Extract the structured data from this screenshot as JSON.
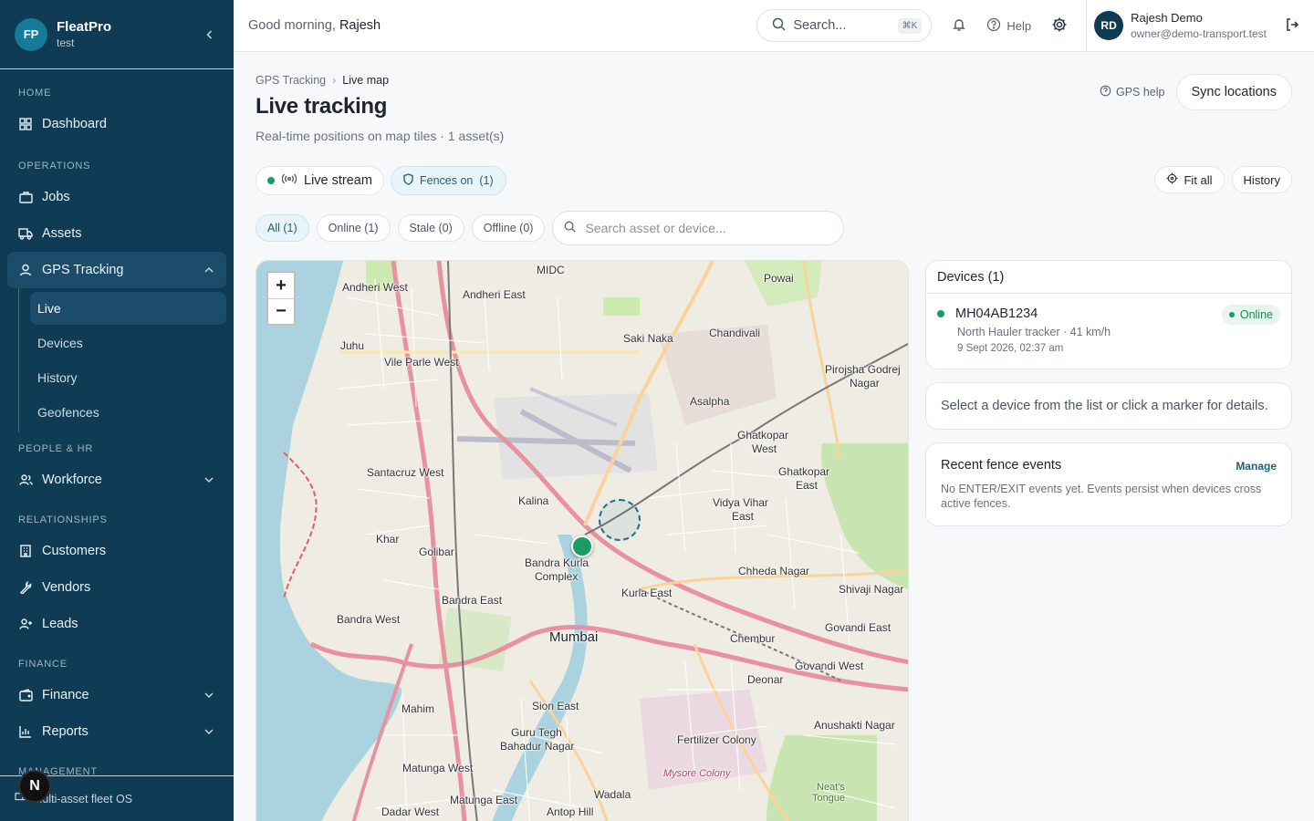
{
  "sidebar": {
    "brand": {
      "initials": "FP",
      "name": "FleatPro",
      "sub": "test"
    },
    "sections": {
      "home": "HOME",
      "operations": "OPERATIONS",
      "people": "PEOPLE & HR",
      "relationships": "RELATIONSHIPS",
      "finance": "FINANCE",
      "management": "MANAGEMENT"
    },
    "items": {
      "dashboard": "Dashboard",
      "jobs": "Jobs",
      "assets": "Assets",
      "gps": "GPS Tracking",
      "workforce": "Workforce",
      "customers": "Customers",
      "vendors": "Vendors",
      "leads": "Leads",
      "finance": "Finance",
      "reports": "Reports"
    },
    "gps_sub": {
      "live": "Live",
      "devices": "Devices",
      "history": "History",
      "geofences": "Geofences"
    },
    "footer": "Multi-asset fleet OS",
    "n_badge": "N"
  },
  "header": {
    "greeting": "Good morning,",
    "user_first": "Rajesh",
    "search_label": "Search...",
    "search_kbd": "⌘K",
    "help": "Help",
    "user_initials": "RD",
    "user_name": "Rajesh Demo",
    "user_email": "owner@demo-transport.test"
  },
  "page": {
    "breadcrumb_parent": "GPS Tracking",
    "breadcrumb_current": "Live map",
    "title": "Live tracking",
    "subtitle": "Real-time positions on map tiles · 1 asset(s)",
    "gps_help": "GPS help",
    "sync": "Sync locations",
    "live_stream": "Live stream",
    "fences_on": "Fences on",
    "fences_count": "(1)",
    "fit_all": "Fit all",
    "history": "History",
    "filters": [
      "All (1)",
      "Online (1)",
      "Stale (0)",
      "Offline (0)"
    ],
    "asset_search_placeholder": "Search asset or device..."
  },
  "map": {
    "zoom_in": "+",
    "zoom_out": "−",
    "labels": {
      "andheri_west": "Andheri West",
      "andheri_east": "Andheri East",
      "midc": "MIDC",
      "powai": "Powai",
      "juhu": "Juhu",
      "vile_parle": "Vile Parle West",
      "saki_naka": "Saki Naka",
      "chandivali": "Chandivali",
      "pirojsha": "Pirojsha Godrej",
      "nagar": "Nagar",
      "asalpha": "Asalpha",
      "ghatkopar_w": "Ghatkopar",
      "ghatkopar_w2": "West",
      "ghatkopar_e": "Ghatkopar",
      "ghatkopar_e2": "East",
      "santacruz": "Santacruz West",
      "kalina": "Kalina",
      "vidya": "Vidya Vihar",
      "vidya2": "East",
      "khar": "Khar",
      "golibar": "Golibar",
      "bkc": "Bandra Kurla",
      "bkc2": "Complex",
      "chheda": "Chheda Nagar",
      "shivaji": "Shivaji Nagar",
      "kurla_east": "Kurla East",
      "bandra_east": "Bandra East",
      "bandra_west": "Bandra West",
      "mumbai": "Mumbai",
      "chembur": "Chembur",
      "govandi_east": "Govandi East",
      "govandi_west": "Govandi West",
      "deonar": "Deonar",
      "mahim": "Mahim",
      "sion_east": "Sion East",
      "anushakti": "Anushakti Nagar",
      "guru": "Guru Tegh",
      "guru2": "Bahadur Nagar",
      "fertilizer": "Fertilizer Colony",
      "matunga_w": "Matunga West",
      "matunga_e": "Matunga East",
      "wadala": "Wadala",
      "dadar": "Dadar West",
      "antop": "Antop Hill",
      "mysore": "Mysore Colony",
      "neats": "Neat's",
      "neats2": "Tongue"
    }
  },
  "devices_panel": {
    "title": "Devices (1)",
    "device_id": "MH04AB1234",
    "device_meta": "North Hauler tracker · 41 km/h",
    "device_time": "9 Sept 2026, 02:37 am",
    "status": "Online",
    "hint": "Select a device from the list or click a marker for details."
  },
  "fence_events": {
    "title": "Recent fence events",
    "manage": "Manage",
    "text": "No ENTER/EXIT events yet. Events persist when devices cross active fences."
  },
  "colors": {
    "sidebar": "#0f3b55",
    "accent": "#1d5f7c",
    "online": "#1a9d62"
  }
}
